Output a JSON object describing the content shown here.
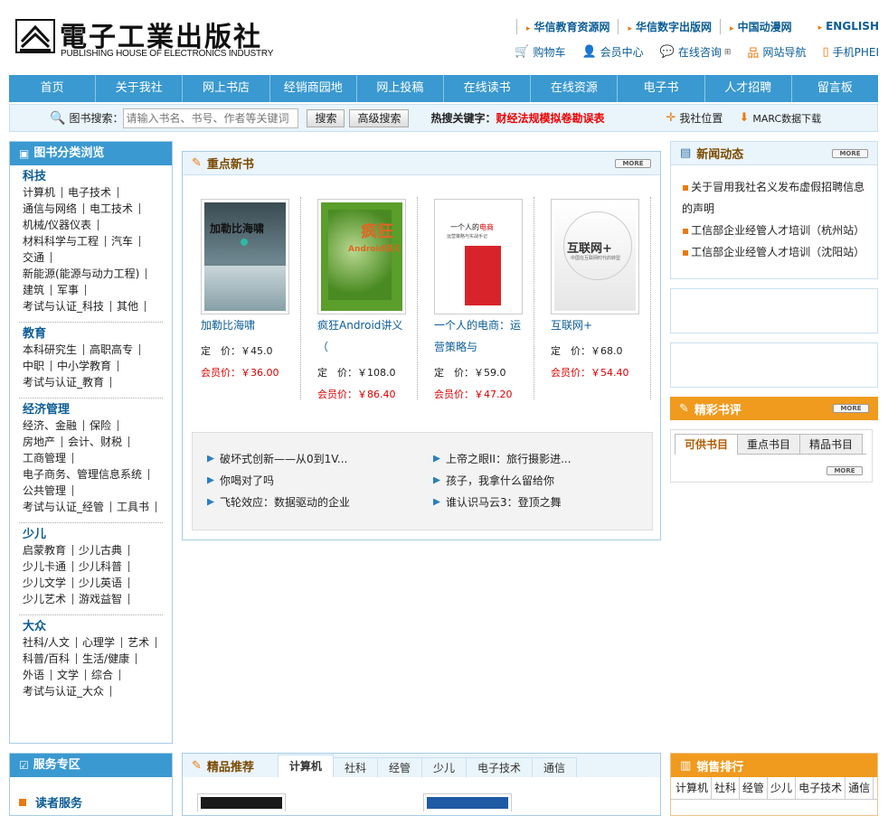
{
  "header": {
    "logo_cn": "電子工業出版社",
    "logo_en": "PUBLISHING HOUSE OF ELECTRONICS INDUSTRY",
    "top_links": [
      "华信教育资源网",
      "华信数字出版网",
      "中国动漫网"
    ],
    "english": "ENGLISH",
    "tools": [
      {
        "label": "购物车",
        "icon": "cart-icon"
      },
      {
        "label": "会员中心",
        "icon": "member-icon"
      },
      {
        "label": "在线咨询",
        "icon": "chat-icon"
      },
      {
        "label": "网站导航",
        "icon": "sitemap-icon"
      },
      {
        "label": "手机PHEI",
        "icon": "mobile-icon"
      }
    ]
  },
  "nav": [
    "首页",
    "关于我社",
    "网上书店",
    "经销商园地",
    "网上投稿",
    "在线读书",
    "在线资源",
    "电子书",
    "人才招聘",
    "留言板"
  ],
  "search": {
    "label": "图书搜索：",
    "placeholder": "请输入书名、书号、作者等关键词",
    "search_btn": "搜索",
    "adv_btn": "高级搜索",
    "hot_label": "热搜关键字：",
    "hot_keyword": "财经法规模拟卷勘误表",
    "location": "我社位置",
    "marc": "MARC数据下载"
  },
  "categories": {
    "title": "图书分类浏览",
    "groups": [
      {
        "name": "科技",
        "items": [
          "计算机",
          "电子技术",
          "通信与网络",
          "电工技术",
          "机械/仪器仪表",
          "材料科学与工程",
          "汽车",
          "交通",
          "新能源(能源与动力工程)",
          "建筑",
          "军事",
          "考试与认证_科技",
          "其他"
        ]
      },
      {
        "name": "教育",
        "items": [
          "本科研究生",
          "高职高专",
          "中职",
          "中小学教育",
          "考试与认证_教育"
        ]
      },
      {
        "name": "经济管理",
        "items": [
          "经济、金融",
          "保险",
          "房地产",
          "会计、财税",
          "工商管理",
          "电子商务、管理信息系统",
          "公共管理",
          "考试与认证_经管",
          "工具书"
        ]
      },
      {
        "name": "少儿",
        "items": [
          "启蒙教育",
          "少儿古典",
          "少儿卡通",
          "少儿科普",
          "少儿文学",
          "少儿英语",
          "少儿艺术",
          "游戏益智"
        ]
      },
      {
        "name": "大众",
        "items": [
          "社科/人文",
          "心理学",
          "艺术",
          "科普/百科",
          "生活/健康",
          "外语",
          "文学",
          "综合",
          "考试与认证_大众"
        ]
      }
    ]
  },
  "service": {
    "title": "服务专区",
    "first": "读者服务"
  },
  "featured": {
    "title": "重点新书",
    "more": "MORE",
    "books": [
      {
        "title": "加勒比海啸",
        "price_label": "定　价：",
        "price": "￥45.0",
        "member_label": "会员价：",
        "member_price": "￥36.00"
      },
      {
        "title": "疯狂Android讲义（",
        "price_label": "定　价：",
        "price": "￥108.0",
        "member_label": "会员价：",
        "member_price": "￥86.40"
      },
      {
        "title": "一个人的电商：运营策略与",
        "price_label": "定　价：",
        "price": "￥59.0",
        "member_label": "会员价：",
        "member_price": "￥47.20"
      },
      {
        "title": "互联网+",
        "price_label": "定　价：",
        "price": "￥68.0",
        "member_label": "会员价：",
        "member_price": "￥54.40"
      }
    ],
    "links": [
      "破坏式创新——从0到1V...",
      "上帝之眼II：旅行摄影进...",
      "你喝对了吗",
      "孩子，我拿什么留给你",
      "飞轮效应：数据驱动的企业",
      "谁认识马云3：登顶之舞"
    ]
  },
  "news": {
    "title": "新闻动态",
    "more": "MORE",
    "items": [
      "关于冒用我社名义发布虚假招聘信息的声明",
      "工信部企业经管人才培训（杭州站）",
      "工信部企业经管人才培训（沈阳站）"
    ]
  },
  "reviews": {
    "title": "精彩书评",
    "more": "MORE",
    "tabs": [
      "可供书目",
      "重点书目",
      "精品书目"
    ]
  },
  "recommend": {
    "title": "精品推荐",
    "tabs": [
      "计算机",
      "社科",
      "经管",
      "少儿",
      "电子技术",
      "通信"
    ]
  },
  "ranking": {
    "title": "销售排行",
    "tabs": [
      "计算机",
      "社科",
      "经管",
      "少儿",
      "电子技术",
      "通信"
    ]
  },
  "colors": {
    "nav_blue": "#3a99d0",
    "link_blue": "#0b5c96",
    "accent_orange": "#e87a10",
    "price_red": "#d00"
  }
}
